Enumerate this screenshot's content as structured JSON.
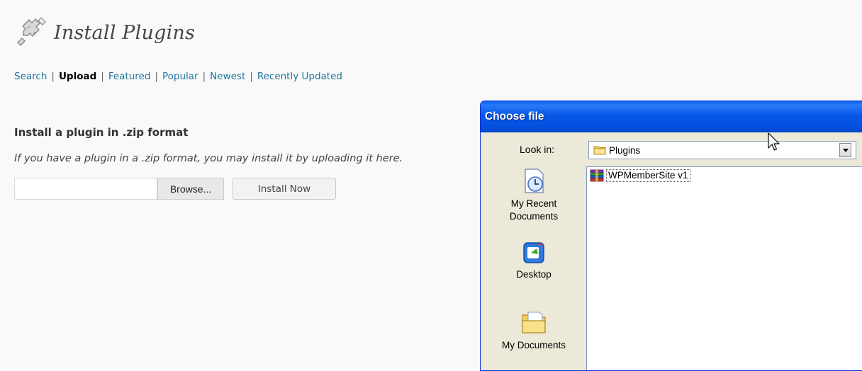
{
  "page": {
    "title": "Install Plugins",
    "icon": "plugin-icon"
  },
  "subnav": {
    "items": [
      {
        "label": "Search",
        "current": false
      },
      {
        "label": "Upload",
        "current": true
      },
      {
        "label": "Featured",
        "current": false
      },
      {
        "label": "Popular",
        "current": false
      },
      {
        "label": "Newest",
        "current": false
      },
      {
        "label": "Recently Updated",
        "current": false
      }
    ],
    "separator": "|"
  },
  "upload": {
    "heading": "Install a plugin in .zip format",
    "description": "If you have a plugin in a .zip format, you may install it by uploading it here.",
    "file_value": "",
    "browse_label": "Browse...",
    "install_label": "Install Now"
  },
  "dialog": {
    "title": "Choose file",
    "look_in_label": "Look in:",
    "look_in_value": "Plugins",
    "places": [
      {
        "label": "My Recent\nDocuments",
        "icon": "recent-documents-icon"
      },
      {
        "label": "Desktop",
        "icon": "desktop-icon"
      },
      {
        "label": "My Documents",
        "icon": "my-documents-icon"
      }
    ],
    "files": [
      {
        "name": "WPMemberSite v1",
        "icon": "winrar-archive-icon"
      }
    ]
  },
  "colors": {
    "link": "#21759b",
    "titlebar": "#0858e8",
    "dialog_bg": "#ece9d8"
  }
}
